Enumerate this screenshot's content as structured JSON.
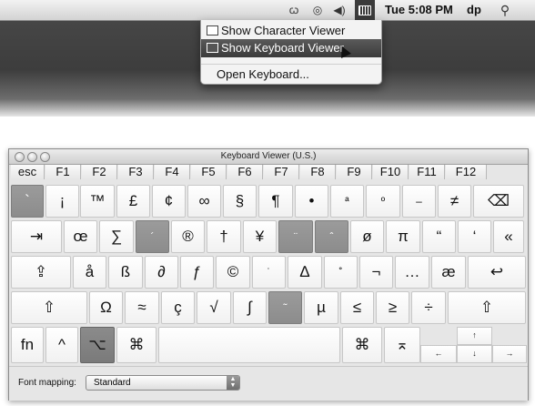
{
  "menubar": {
    "time": "Tue 5:08 PM",
    "user": "dp",
    "icons": [
      "script-icon",
      "timemachine-icon",
      "volume-icon",
      "keyboard-viewer-icon",
      "spotlight-icon"
    ]
  },
  "input_menu": {
    "items": [
      {
        "label": "Show Character Viewer",
        "highlighted": false
      },
      {
        "label": "Show Keyboard Viewer",
        "highlighted": true
      },
      {
        "label": "Open Keyboard...",
        "highlighted": false
      }
    ]
  },
  "window": {
    "title": "Keyboard Viewer (U.S.)",
    "function_keys": [
      "esc",
      "F1",
      "F2",
      "F3",
      "F4",
      "F5",
      "F6",
      "F7",
      "F8",
      "F9",
      "F10",
      "F11",
      "F12"
    ],
    "rows": {
      "r1": [
        "`",
        "¡",
        "™",
        "£",
        "¢",
        "∞",
        "§",
        "¶",
        "•",
        "ª",
        "º",
        "–",
        "≠",
        "⌫"
      ],
      "r2": [
        "⇥",
        "œ",
        "∑",
        "´",
        "®",
        "†",
        "¥",
        "¨",
        "ˆ",
        "ø",
        "π",
        "“",
        "‘",
        "«"
      ],
      "r3": [
        "⇪",
        "å",
        "ß",
        "∂",
        "ƒ",
        "©",
        "˙",
        "∆",
        "˚",
        "¬",
        "…",
        "æ",
        "↩"
      ],
      "r4": [
        "⇧",
        "Ω",
        "≈",
        "ç",
        "√",
        "∫",
        "˜",
        "µ",
        "≤",
        "≥",
        "÷",
        "⇧"
      ],
      "r5": [
        "fn",
        "^",
        "⌥",
        "⌘",
        "",
        "⌘",
        "⌅"
      ]
    },
    "arrows": [
      "↑",
      "←",
      "↓",
      "→"
    ],
    "font_mapping_label": "Font mapping:",
    "font_mapping_value": "Standard"
  }
}
